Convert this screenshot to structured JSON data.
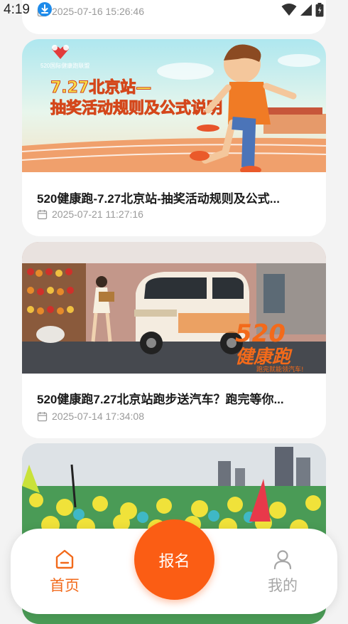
{
  "status_bar": {
    "time": "4:19",
    "icons": [
      "download-icon",
      "wifi-icon",
      "signal-icon",
      "battery-icon"
    ]
  },
  "articles": [
    {
      "date": "2025-07-16 15:26:46"
    },
    {
      "banner_logo_text": "520国际健康跑联盟",
      "banner_line1": "7.27北京站—",
      "banner_line2": "抽奖活动规则及公式说明",
      "title": "520健康跑-7.27北京站-抽奖活动规则及公式...",
      "date": "2025-07-21 11:27:16"
    },
    {
      "banner_text_1": "520",
      "banner_text_2": "健康跑",
      "banner_small": "跑完就能领汽车!",
      "title": "520健康跑7.27北京站跑步送汽车？跑完等你...",
      "date": "2025-07-14 17:34:08"
    },
    {
      "image": "crowd-running-photo"
    }
  ],
  "nav": {
    "home_label": "首页",
    "signup_label": "报名",
    "me_label": "我的"
  },
  "colors": {
    "accent": "#fb5d14",
    "nav_active": "#f26a1b",
    "nav_inactive": "#a6a6a6"
  }
}
